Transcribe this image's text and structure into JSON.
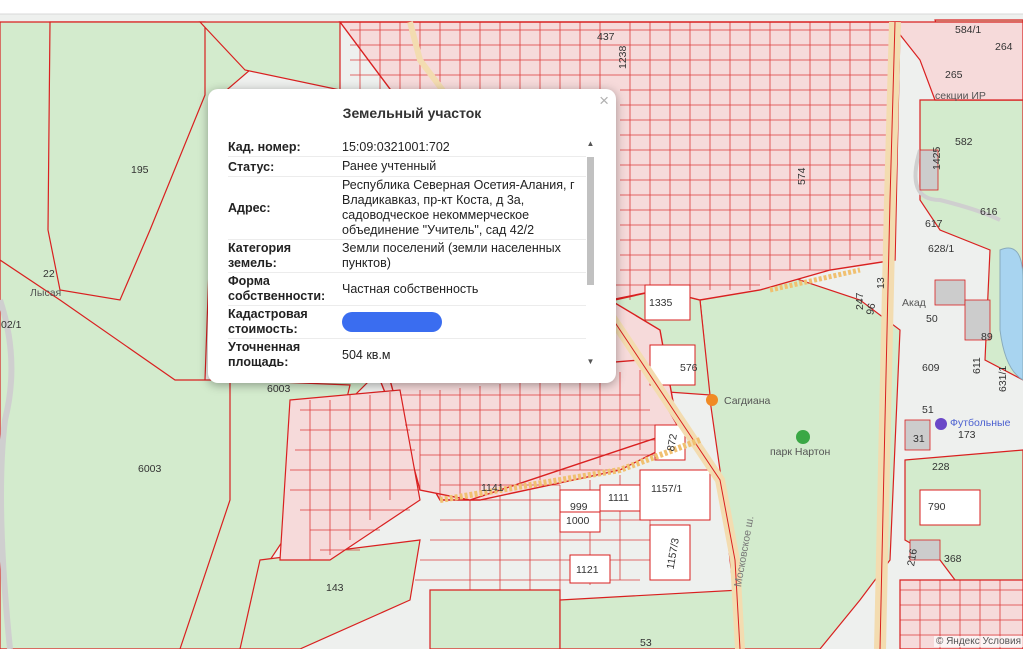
{
  "map": {
    "background_color": "#f2f2f2",
    "parcel_fill": "#cde8c8",
    "parcel_stroke": "#d92020",
    "road_color": "#f7e6c4",
    "labels": [
      {
        "id": "195",
        "text": "195"
      },
      {
        "id": "6003a",
        "text": "6003"
      },
      {
        "id": "6003b",
        "text": "6003"
      },
      {
        "id": "143",
        "text": "143"
      },
      {
        "id": "1335",
        "text": "1335"
      },
      {
        "id": "576",
        "text": "576"
      },
      {
        "id": "872",
        "text": "872"
      },
      {
        "id": "1141",
        "text": "1141"
      },
      {
        "id": "999",
        "text": "999"
      },
      {
        "id": "1111",
        "text": "1111"
      },
      {
        "id": "1000",
        "text": "1000"
      },
      {
        "id": "1157_1",
        "text": "1157/1"
      },
      {
        "id": "1157_3",
        "text": "1157/3"
      },
      {
        "id": "1121",
        "text": "1121"
      },
      {
        "id": "53",
        "text": "53"
      },
      {
        "id": "582",
        "text": "582"
      },
      {
        "id": "616",
        "text": "616"
      },
      {
        "id": "617",
        "text": "617"
      },
      {
        "id": "628_1",
        "text": "628/1"
      },
      {
        "id": "50",
        "text": "50"
      },
      {
        "id": "609",
        "text": "609"
      },
      {
        "id": "611",
        "text": "611"
      },
      {
        "id": "631_1",
        "text": "631/1"
      },
      {
        "id": "51",
        "text": "51"
      },
      {
        "id": "173",
        "text": "173"
      },
      {
        "id": "31",
        "text": "31"
      },
      {
        "id": "228",
        "text": "228"
      },
      {
        "id": "790",
        "text": "790"
      },
      {
        "id": "368",
        "text": "368"
      },
      {
        "id": "216",
        "text": "216"
      },
      {
        "id": "247",
        "text": "247"
      },
      {
        "id": "265",
        "text": "265"
      },
      {
        "id": "264",
        "text": "264"
      },
      {
        "id": "584_1",
        "text": "584/1"
      },
      {
        "id": "574",
        "text": "574"
      },
      {
        "id": "1425",
        "text": "1425"
      },
      {
        "id": "96",
        "text": "96"
      },
      {
        "id": "13",
        "text": "13"
      },
      {
        "id": "89",
        "text": "89"
      },
      {
        "id": "02_1",
        "text": "02/1"
      },
      {
        "id": "22",
        "text": "22"
      },
      {
        "id": "437",
        "text": "437"
      },
      {
        "id": "1238",
        "text": "1238"
      }
    ],
    "places": [
      {
        "id": "lysaya",
        "text": "Лысая"
      },
      {
        "id": "sagdiana",
        "text": "Сагдиана"
      },
      {
        "id": "park_narton",
        "text": "парк Нартон"
      },
      {
        "id": "football",
        "text": "Футбольные"
      },
      {
        "id": "sekcii",
        "text": "секции ИР"
      },
      {
        "id": "akad",
        "text": "Акад"
      },
      {
        "id": "street_moskovskoe",
        "text": "Московское ш."
      }
    ],
    "attribution": "© Яндекс Условия"
  },
  "popup": {
    "title": "Земельный участок",
    "close_label": "×",
    "rows": [
      {
        "key": "Кад. номер:",
        "value": "15:09:0321001:702"
      },
      {
        "key": "Статус:",
        "value": "Ранее учтенный"
      },
      {
        "key": "Адрес:",
        "value": "Республика Северная Осетия-Алания, г Владикавказ, пр-кт Коста, д 3а, садоводческое некоммерческое объединение \"Учитель\", сад 42/2"
      },
      {
        "key": "Категория земель:",
        "value": "Земли поселений (земли населенных пунктов)"
      },
      {
        "key": "Форма собственности:",
        "value": "Частная собственность"
      },
      {
        "key": "Кадастровая стоимость:",
        "value": ""
      },
      {
        "key": "Уточненная площадь:",
        "value": "504 кв.м"
      }
    ],
    "scroll_up_icon": "▲",
    "scroll_down_icon": "▼",
    "redaction_color": "#3a6df0"
  }
}
